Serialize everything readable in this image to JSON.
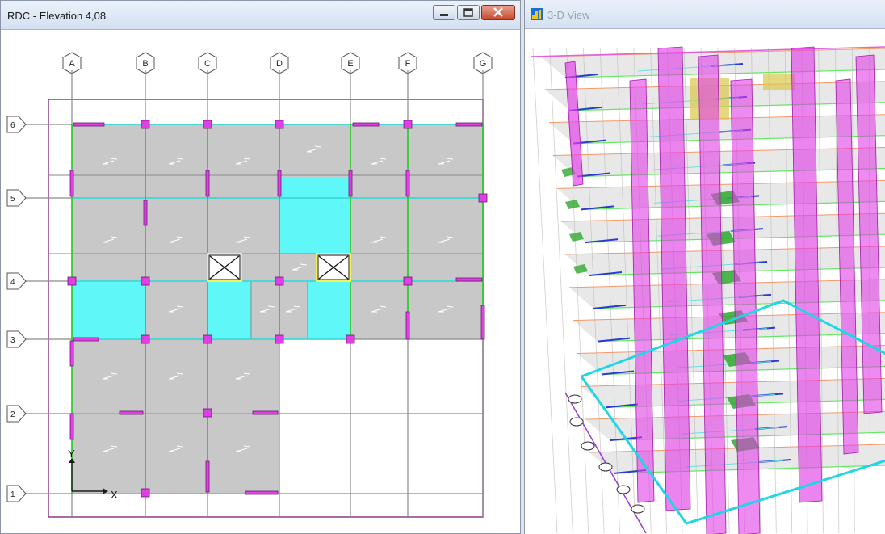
{
  "left_window": {
    "title": "RDC - Elevation 4,08",
    "grid_x_labels": [
      "A",
      "B",
      "C",
      "D",
      "E",
      "F",
      "G"
    ],
    "grid_y_labels": [
      "6",
      "5",
      "4",
      "3",
      "2",
      "1"
    ],
    "axis_x_label": "X",
    "axis_y_label": "Y"
  },
  "right_window": {
    "title": "3-D View"
  },
  "colors": {
    "slab": "#c8c8c8",
    "opening": "#5ff7f7",
    "column": "#e23ee8",
    "beam": "#1fd11f",
    "grid": "#8a8a8a",
    "border": "#8a3a8a"
  },
  "icons": [
    "minimize-icon",
    "maximize-icon",
    "close-icon",
    "window-app-icon",
    "slab-direction-icon",
    "opening-cross-icon",
    "column-icon",
    "axis-icon"
  ]
}
